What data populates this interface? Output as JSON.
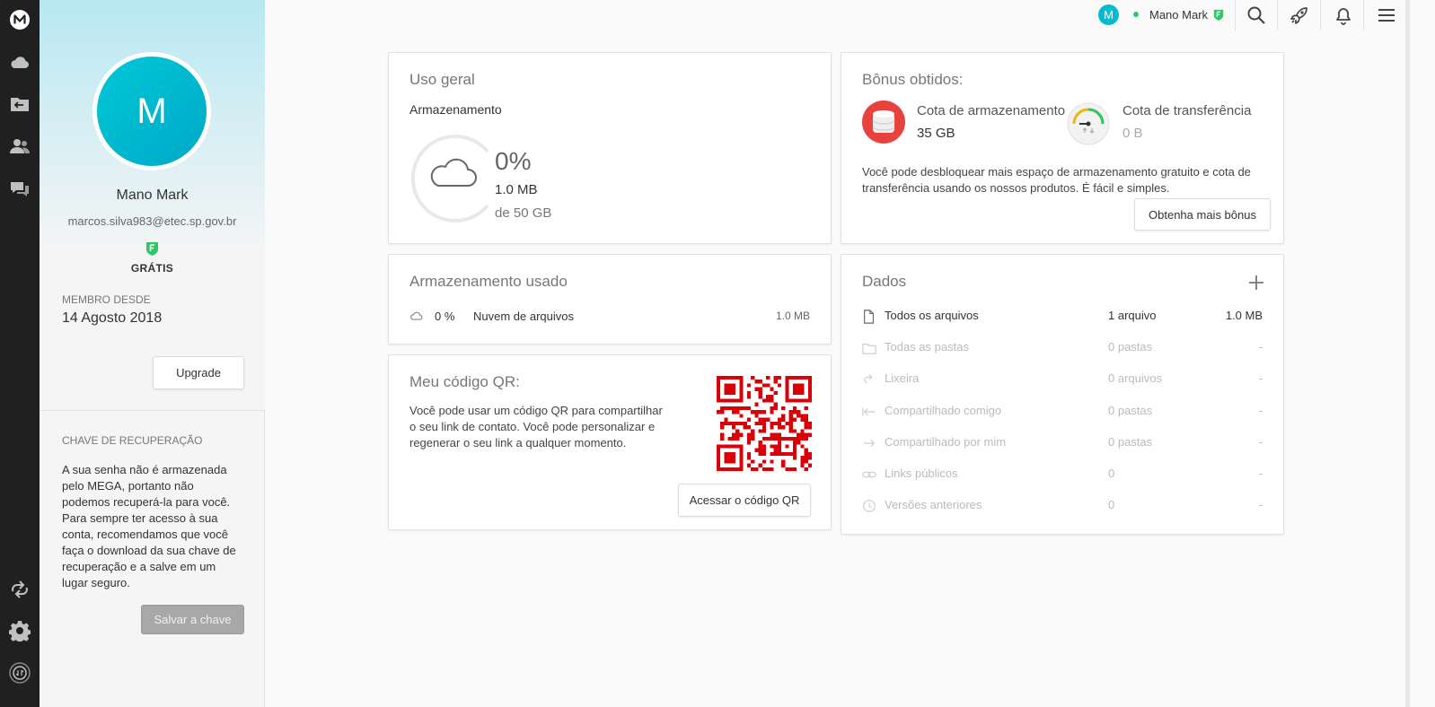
{
  "user": {
    "initial": "M",
    "name": "Mano Mark",
    "email": "marcos.silva983@etec.sp.gov.br",
    "plan": "GRÁTIS",
    "member_since_label": "MEMBRO DESDE",
    "member_since": "14 Agosto 2018",
    "upgrade_label": "Upgrade"
  },
  "recovery": {
    "title": "CHAVE DE RECUPERAÇÃO",
    "text": "A sua senha não é armazenada pelo MEGA, portanto não podemos recuperá-la para você. Para sempre ter acesso à sua conta, recomendamos que você faça o download da sua chave de recuperação e a salve em um lugar seguro.",
    "button": "Salvar a chave"
  },
  "topbar": {
    "avatar_initial": "M",
    "user_name": "Mano Mark",
    "icons": [
      "search-icon",
      "rocket-icon",
      "bell-icon",
      "menu-icon"
    ]
  },
  "sidebar_icons": [
    "mega-logo-icon",
    "cloud-drive-icon",
    "shared-folders-icon",
    "contacts-icon",
    "chat-icon",
    "sync-icon",
    "settings-icon",
    "transfers-icon"
  ],
  "usage": {
    "title": "Uso geral",
    "subtitle": "Armazenamento",
    "percent": "0%",
    "used": "1.0 MB",
    "total": "de 50 GB",
    "fraction": 0
  },
  "bonus": {
    "title": "Bônus obtidos:",
    "storage_label": "Cota de armazenamento",
    "storage_value": "35 GB",
    "transfer_label": "Cota de transferência",
    "transfer_value": "0 B",
    "description": "Você pode desbloquear mais espaço de armazenamento gratuito e cota de transferência usando os nossos produtos. É fácil e simples.",
    "button": "Obtenha mais bônus"
  },
  "storage_used": {
    "title": "Armazenamento usado",
    "percent": "0 %",
    "label": "Nuvem de arquivos",
    "size": "1.0 MB"
  },
  "qr": {
    "title": "Meu código QR:",
    "text": "Você pode usar um código QR para compartilhar o seu link de contato. Você pode personalizar e regenerar o seu link a qualquer momento.",
    "button": "Acessar o código QR",
    "color": "#d90007"
  },
  "dados": {
    "title": "Dados",
    "rows": [
      {
        "icon": "file-icon",
        "label": "Todos os arquivos",
        "count": "1 arquivo",
        "size": "1.0 MB"
      },
      {
        "icon": "folder-icon",
        "label": "Todas as pastas",
        "count": "0 pastas",
        "size": "-"
      },
      {
        "icon": "rubbish-bin-icon",
        "label": "Lixeira",
        "count": "0 arquivos",
        "size": "-"
      },
      {
        "icon": "incoming-share-icon",
        "label": "Compartilhado comigo",
        "count": "0 pastas",
        "size": "-"
      },
      {
        "icon": "outgoing-share-icon",
        "label": "Compartilhado por mim",
        "count": "0 pastas",
        "size": "-"
      },
      {
        "icon": "link-icon",
        "label": "Links públicos",
        "count": "0",
        "size": "-"
      },
      {
        "icon": "versions-icon",
        "label": "Versões anteriores",
        "count": "0",
        "size": "-"
      }
    ]
  },
  "colors": {
    "accent": "#00bcd0",
    "mega_red": "#d90007",
    "sidebar_bg": "#202020",
    "badge_green": "#2fc76a"
  }
}
